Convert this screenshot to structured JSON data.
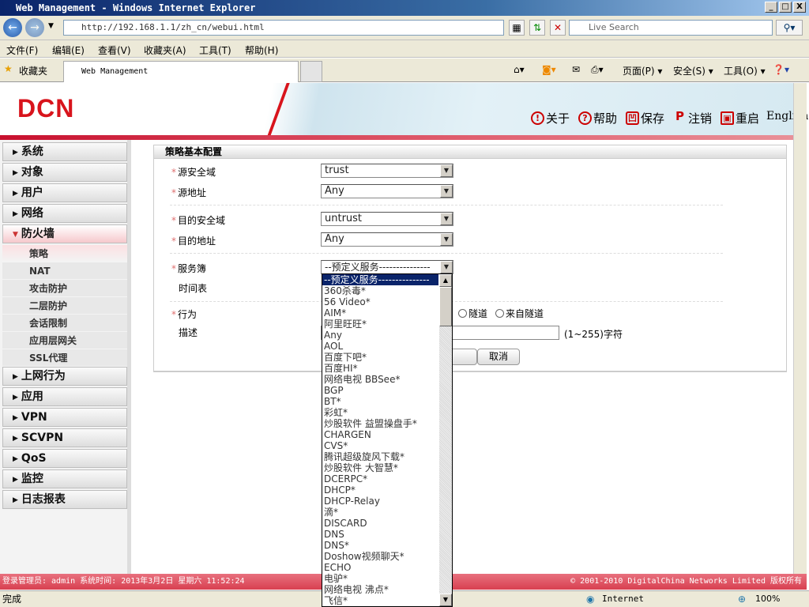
{
  "window": {
    "title": "Web Management - Windows Internet Explorer",
    "min": "_",
    "max": "□",
    "close": "X"
  },
  "browser": {
    "url": "http://192.168.1.1/zh_cn/webui.html",
    "search_placeholder": "Live Search",
    "menu": [
      "文件(F)",
      "编辑(E)",
      "查看(V)",
      "收藏夹(A)",
      "工具(T)",
      "帮助(H)"
    ],
    "favorites": "收藏夹",
    "tab": "Web Management",
    "commands": [
      "页面(P) ▾",
      "安全(S) ▾",
      "工具(O) ▾"
    ],
    "status": "完成",
    "zone": "Internet",
    "zoom": "100%"
  },
  "header": {
    "logo": "DCN",
    "links": [
      {
        "icon": "!",
        "label": "关于"
      },
      {
        "icon": "?",
        "label": "帮助"
      },
      {
        "icon": "凹",
        "label": "保存"
      },
      {
        "icon": "P",
        "label": "注销"
      },
      {
        "icon": "▣",
        "label": "重启"
      }
    ],
    "english": "English"
  },
  "sidebar": {
    "items": [
      "系统",
      "对象",
      "用户",
      "网络",
      "防火墙"
    ],
    "sub": [
      "策略",
      "NAT",
      "攻击防护",
      "二层防护",
      "会话限制",
      "应用层网关",
      "SSL代理"
    ],
    "items2": [
      "上网行为",
      "应用",
      "VPN",
      "SCVPN",
      "QoS",
      "监控",
      "日志报表"
    ]
  },
  "form": {
    "title": "策略基本配置",
    "src_zone_label": "源安全域",
    "src_zone": "trust",
    "src_addr_label": "源地址",
    "src_addr": "Any",
    "dst_zone_label": "目的安全域",
    "dst_zone": "untrust",
    "dst_addr_label": "目的地址",
    "dst_addr": "Any",
    "service_label": "服务簿",
    "service": "--预定义服务---------------",
    "schedule_label": "时间表",
    "action_label": "行为",
    "action_tunnel": "隧道",
    "action_from_tunnel": "来自隧道",
    "desc_label": "描述",
    "desc_hint": "(1~255)字符",
    "cancel": "取消"
  },
  "service_options": [
    "--预定义服务---------------",
    "360杀毒*",
    "56 Video*",
    "AIM*",
    "阿里旺旺*",
    "Any",
    "AOL",
    "百度下吧*",
    "百度HI*",
    "网络电视 BBSee*",
    "BGP",
    "BT*",
    "彩虹*",
    "炒股软件 益盟操盘手*",
    "CHARGEN",
    "CVS*",
    "腾讯超级旋风下载*",
    "炒股软件 大智慧*",
    "DCERPC*",
    "DHCP*",
    "DHCP-Relay",
    "滴*",
    "DISCARD",
    "DNS",
    "DNS*",
    "Doshow视频聊天*",
    "ECHO",
    "电驴*",
    "网络电视 沸点*",
    "飞信*"
  ],
  "footer": {
    "left": "登录管理员: admin 系统时间: 2013年3月2日 星期六 11:52:24",
    "right": "© 2001-2010 DigitalChina Networks Limited 版权所有"
  }
}
